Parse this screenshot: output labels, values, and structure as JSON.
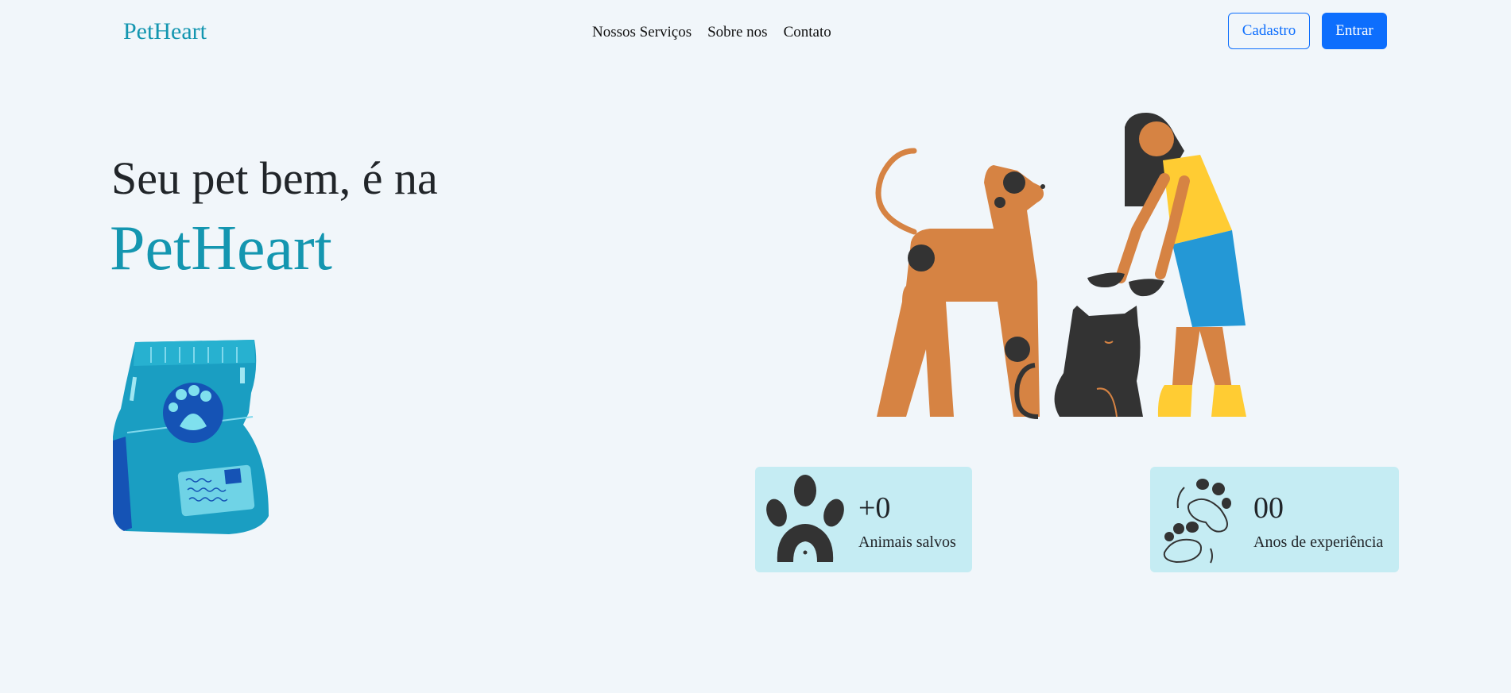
{
  "navbar": {
    "brand": "PetHeart",
    "links": [
      "Nossos Serviços",
      "Sobre nos",
      "Contato"
    ],
    "signup_label": "Cadastro",
    "login_label": "Entrar"
  },
  "hero": {
    "line1": "Seu pet bem, é na",
    "line2": "PetHeart"
  },
  "stats": [
    {
      "value": "+0",
      "label": "Animais salvos",
      "icon": "paw-icon"
    },
    {
      "value": "00",
      "label": "Anos de experiência",
      "icon": "paw-prints-icon"
    }
  ],
  "colors": {
    "brand": "#1496b0",
    "primary": "#0d6efd",
    "background": "#f1f6fa",
    "card": "#c5ecf3"
  }
}
